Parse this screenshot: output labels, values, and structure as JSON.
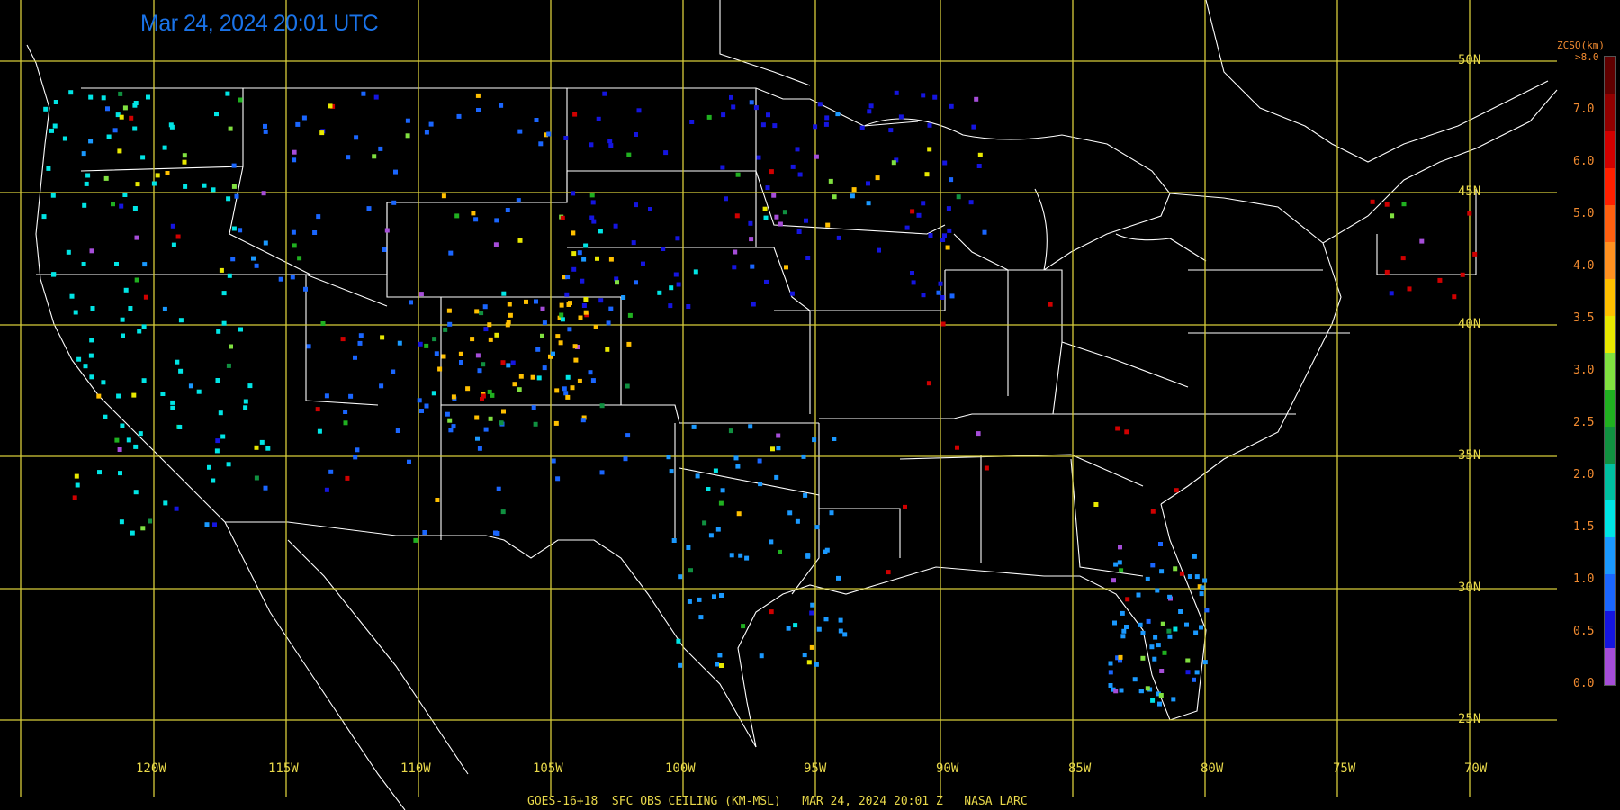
{
  "timestamp": "Mar 24, 2024 20:01 UTC",
  "footer": "GOES-16+18  SFC OBS CEILING (KM-MSL)   MAR 24, 2024 20:01 Z   NASA LARC",
  "lat_labels": [
    "50N",
    "45N",
    "40N",
    "35N",
    "30N",
    "25N"
  ],
  "lon_labels": [
    "120W",
    "115W",
    "110W",
    "105W",
    "100W",
    "95W",
    "90W",
    "85W",
    "80W",
    "75W",
    "70W"
  ],
  "colorbar": {
    "title": "ZCSO(km)",
    "top_label": ">8.0",
    "ticks": [
      "7.0",
      "6.0",
      "5.0",
      "4.0",
      "3.5",
      "3.0",
      "2.5",
      "2.0",
      "1.5",
      "1.0",
      "0.5",
      "0.0"
    ],
    "colors": [
      "#a64dd9",
      "#1515e0",
      "#1a66ff",
      "#1a99ff",
      "#00e5e5",
      "#00c0a0",
      "#109040",
      "#20b020",
      "#80e040",
      "#e8e800",
      "#ffc000",
      "#ff9020",
      "#ff6010",
      "#ff2000",
      "#d00000",
      "#900000",
      "#600000"
    ]
  },
  "stations": [
    {
      "region": "pacific-nw",
      "color": "#00e5e5"
    },
    {
      "region": "upper-midwest",
      "color": "#1515e0"
    },
    {
      "region": "plains",
      "color": "#1a66ff"
    },
    {
      "region": "colorado",
      "color": "#ffc000"
    },
    {
      "region": "texas",
      "color": "#1a99ff"
    },
    {
      "region": "southeast",
      "color": "#d00000"
    }
  ]
}
